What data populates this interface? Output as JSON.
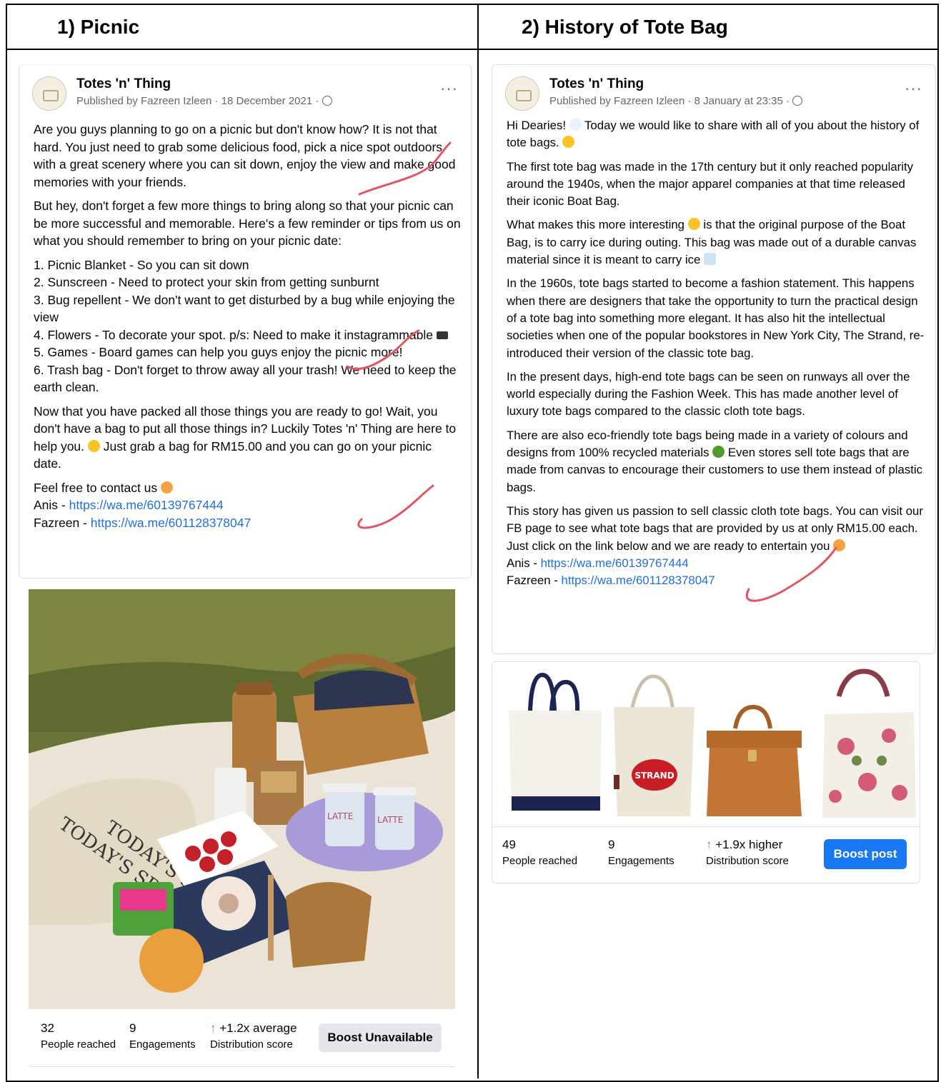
{
  "columns": [
    {
      "title": "1)  Picnic"
    },
    {
      "title": "2)  History of Tote Bag"
    }
  ],
  "post1": {
    "page_name": "Totes 'n' Thing",
    "byline": "Published by Fazreen Izleen · 18 December 2021 ·",
    "more": "···",
    "p1": "Are you guys planning to go on a picnic but don't know how? It is not that hard. You just need to grab some delicious food, pick a nice spot outdoors with a great scenery where you can sit down, enjoy the view and make good memories with your friends.",
    "p2": "But hey, don't forget a few more things to bring along so that your picnic can be more successful and memorable. Here's a few reminder or tips from us on what you should remember to bring on your picnic date:",
    "list": [
      "1. Picnic Blanket - So you can sit down",
      "2. Sunscreen - Need to protect your skin from getting sunburnt",
      "3. Bug repellent - We don't want to get disturbed by a bug while enjoying the view",
      "4. Flowers - To decorate your spot. p/s: Need to make it instagrammable",
      "5. Games - Board games can help you guys enjoy the picnic more!",
      "6. Trash bag - Don't forget to throw away all your trash! We need to keep the earth clean."
    ],
    "p4a": "Now that you have packed all those things you are ready to go! Wait, you don't have a bag to put all those things in? Luckily Totes 'n' Thing are here to help you.",
    "p4b": "Just grab a bag for RM15.00 and you can go on your picnic date.",
    "contact": "Feel free to contact us",
    "anis_label": "Anis - ",
    "anis_link": "https://wa.me/60139767444",
    "fazreen_label": "Fazreen - ",
    "fazreen_link": "https://wa.me/601128378047",
    "stats": {
      "reached": "32",
      "reached_label": "People reached",
      "engagements": "9",
      "engagements_label": "Engagements",
      "distribution": "↑ +1.2x average",
      "distribution_label": "Distribution score",
      "button": "Boost Unavailable"
    }
  },
  "post2": {
    "page_name": "Totes 'n' Thing",
    "byline": "Published by Fazreen Izleen · 8 January at 23:35 ·",
    "more": "···",
    "p1a": "Hi Dearies!",
    "p1b": "Today we would like to share with all of you about the history of tote bags.",
    "p2": "The first tote bag was made in the 17th century but it only reached popularity around the 1940s, when the major apparel companies at that time released their iconic Boat Bag.",
    "p3a": "What makes this more interesting",
    "p3b": "is that the original purpose of the Boat Bag, is to carry ice during outing. This bag was made out of a durable canvas material since it is meant to carry ice",
    "p4": "In the 1960s, tote bags started to become a fashion statement. This happens when there are designers that take the opportunity to turn the practical design of a tote bag into something more elegant. It has also hit the intellectual societies when one of the popular bookstores in New York City, The Strand, re-introduced their version of the classic tote bag.",
    "p5": "In the present days, high-end tote bags can be seen on runways all over the world especially during the Fashion Week. This has made another level of luxury tote bags compared to the classic cloth tote bags.",
    "p6a": "There are also eco-friendly tote bags being made in a variety of colours and designs from 100% recycled materials",
    "p6b": "Even stores sell tote bags that are made from canvas to encourage their customers to use them instead of plastic bags.",
    "p7": "This story has given us passion to sell classic cloth tote bags. You can visit our FB page to see what tote bags that are provided by us at only RM15.00 each.",
    "p8": "Just click on the link below and we are ready to entertain you",
    "anis_label": "Anis - ",
    "anis_link": "https://wa.me/60139767444",
    "fazreen_label": "Fazreen - ",
    "fazreen_link": "https://wa.me/601128378047",
    "strand_label": "STRAND",
    "stats": {
      "reached": "49",
      "reached_label": "People reached",
      "engagements": "9",
      "engagements_label": "Engagements",
      "distribution": "↑ +1.9x higher",
      "distribution_label": "Distribution score",
      "button": "Boost post"
    }
  },
  "photo_text": {
    "label1": "TODAY'S SPECIAL",
    "label2": "TODAY'S SPECIAL",
    "cup1": "LATTE",
    "cup2": "LATTE"
  },
  "colors": {
    "link": "#216fdb",
    "boost_blue": "#1877f2",
    "gray_button": "#e4e6eb",
    "meta": "#65676b",
    "arrow_green": "#42b72a",
    "scribble": "#e25563"
  }
}
